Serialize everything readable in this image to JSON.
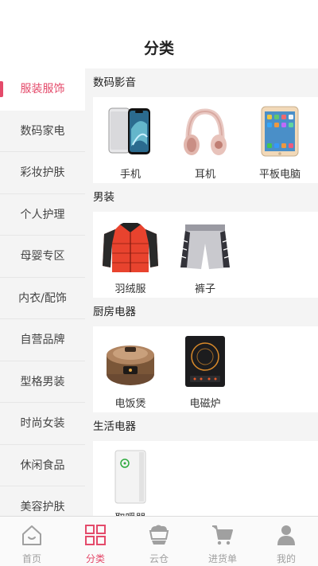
{
  "header": {
    "title": "分类"
  },
  "sidebar": {
    "items": [
      {
        "label": "服装服饰"
      },
      {
        "label": "数码家电"
      },
      {
        "label": "彩妆护肤"
      },
      {
        "label": "个人护理"
      },
      {
        "label": "母婴专区"
      },
      {
        "label": "内衣/配饰"
      },
      {
        "label": "自营品牌"
      },
      {
        "label": "型格男装"
      },
      {
        "label": "时尚女装"
      },
      {
        "label": "休闲食品"
      },
      {
        "label": "美容护肤"
      }
    ]
  },
  "sections": [
    {
      "title": "数码影音",
      "products": [
        {
          "name": "手机",
          "icon": "phone-icon"
        },
        {
          "name": "耳机",
          "icon": "headphones-icon"
        },
        {
          "name": "平板电脑",
          "icon": "tablet-icon"
        }
      ]
    },
    {
      "title": "男装",
      "products": [
        {
          "name": "羽绒服",
          "icon": "down-jacket-icon"
        },
        {
          "name": "裤子",
          "icon": "shorts-icon"
        }
      ]
    },
    {
      "title": "厨房电器",
      "products": [
        {
          "name": "电饭煲",
          "icon": "rice-cooker-icon"
        },
        {
          "name": "电磁炉",
          "icon": "induction-cooker-icon"
        }
      ]
    },
    {
      "title": "生活电器",
      "products": [
        {
          "name": "取暖器",
          "icon": "heater-icon"
        }
      ]
    }
  ],
  "tabbar": {
    "items": [
      {
        "label": "首页",
        "icon": "home-icon"
      },
      {
        "label": "分类",
        "icon": "category-grid-icon"
      },
      {
        "label": "云仓",
        "icon": "cloud-warehouse-icon"
      },
      {
        "label": "进货单",
        "icon": "cart-icon"
      },
      {
        "label": "我的",
        "icon": "user-icon"
      }
    ]
  },
  "colors": {
    "accent": "#e44a6a",
    "inactive": "#a0a0a0",
    "background": "#f4f4f4"
  }
}
